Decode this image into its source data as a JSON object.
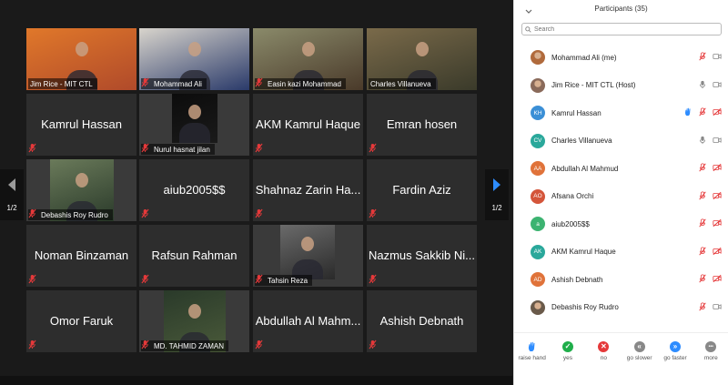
{
  "gallery": {
    "page_indicator_left": "1/2",
    "page_indicator_right": "1/2",
    "tiles": [
      {
        "name": "Jim Rice - MIT CTL",
        "display": "",
        "video": true,
        "active": true
      },
      {
        "name": "Mohammad Ali",
        "display": "",
        "video": true
      },
      {
        "name": "Easin kazi Mohammad",
        "display": "",
        "video": true
      },
      {
        "name": "Charles Villanueva",
        "display": "",
        "video": true
      },
      {
        "name": "",
        "display": "Kamrul Hassan",
        "video": false
      },
      {
        "name": "Nurul hasnat jilan",
        "display": "",
        "video": true
      },
      {
        "name": "",
        "display": "AKM Kamrul Haque",
        "video": false
      },
      {
        "name": "",
        "display": "Emran hosen",
        "video": false
      },
      {
        "name": "Debashis Roy Rudro",
        "display": "",
        "video": true
      },
      {
        "name": "",
        "display": "aiub2005$$",
        "video": false
      },
      {
        "name": "",
        "display": "Shahnaz Zarin Ha...",
        "video": false
      },
      {
        "name": "",
        "display": "Fardin Aziz",
        "video": false
      },
      {
        "name": "",
        "display": "Noman Binzaman",
        "video": false
      },
      {
        "name": "",
        "display": "Rafsun Rahman",
        "video": false
      },
      {
        "name": "Tahsin Reza",
        "display": "",
        "video": true
      },
      {
        "name": "",
        "display": "Nazmus Sakkib Ni...",
        "video": false
      },
      {
        "name": "",
        "display": "Omor Faruk",
        "video": false
      },
      {
        "name": "MD. TAHMID ZAMAN",
        "display": "",
        "video": true
      },
      {
        "name": "",
        "display": "Abdullah Al Mahm...",
        "video": false
      },
      {
        "name": "",
        "display": "Ashish Debnath",
        "video": false
      }
    ]
  },
  "panel": {
    "title": "Participants (35)",
    "search_placeholder": "Search",
    "participants": [
      {
        "name": "Mohammad Ali (me)",
        "initials": "",
        "color": "#b06a3c",
        "mic": "muted",
        "cam": "on",
        "hand": false
      },
      {
        "name": "Jim Rice - MIT CTL (Host)",
        "initials": "",
        "color": "#8a6a5a",
        "mic": "on",
        "cam": "on",
        "hand": false
      },
      {
        "name": "Kamrul Hassan",
        "initials": "KH",
        "color": "#3b8fd6",
        "mic": "muted",
        "cam": "off",
        "hand": true
      },
      {
        "name": "Charles Villanueva",
        "initials": "CV",
        "color": "#2aa89b",
        "mic": "on",
        "cam": "on",
        "hand": false
      },
      {
        "name": "Abdullah Al Mahmud",
        "initials": "AA",
        "color": "#e0733a",
        "mic": "muted",
        "cam": "off",
        "hand": false
      },
      {
        "name": "Afsana Orchi",
        "initials": "AO",
        "color": "#d4553a",
        "mic": "muted",
        "cam": "off",
        "hand": false
      },
      {
        "name": "aiub2005$$",
        "initials": "a",
        "color": "#3cb371",
        "mic": "muted",
        "cam": "off",
        "hand": false
      },
      {
        "name": "AKM Kamrul Haque",
        "initials": "AK",
        "color": "#2aa89b",
        "mic": "muted",
        "cam": "off",
        "hand": false
      },
      {
        "name": "Ashish Debnath",
        "initials": "AD",
        "color": "#e0733a",
        "mic": "muted",
        "cam": "off",
        "hand": false
      },
      {
        "name": "Debashis Roy Rudro",
        "initials": "",
        "color": "#6a5a4a",
        "mic": "muted",
        "cam": "on",
        "hand": false
      }
    ],
    "actions": [
      {
        "label": "raise hand",
        "color": "#2d8cff",
        "glyph": "✋"
      },
      {
        "label": "yes",
        "color": "#1fae4a",
        "glyph": "✓"
      },
      {
        "label": "no",
        "color": "#e5393a",
        "glyph": "✕"
      },
      {
        "label": "go slower",
        "color": "#888888",
        "glyph": "«"
      },
      {
        "label": "go faster",
        "color": "#2d8cff",
        "glyph": "»"
      },
      {
        "label": "more",
        "color": "#888888",
        "glyph": "•••"
      }
    ]
  }
}
